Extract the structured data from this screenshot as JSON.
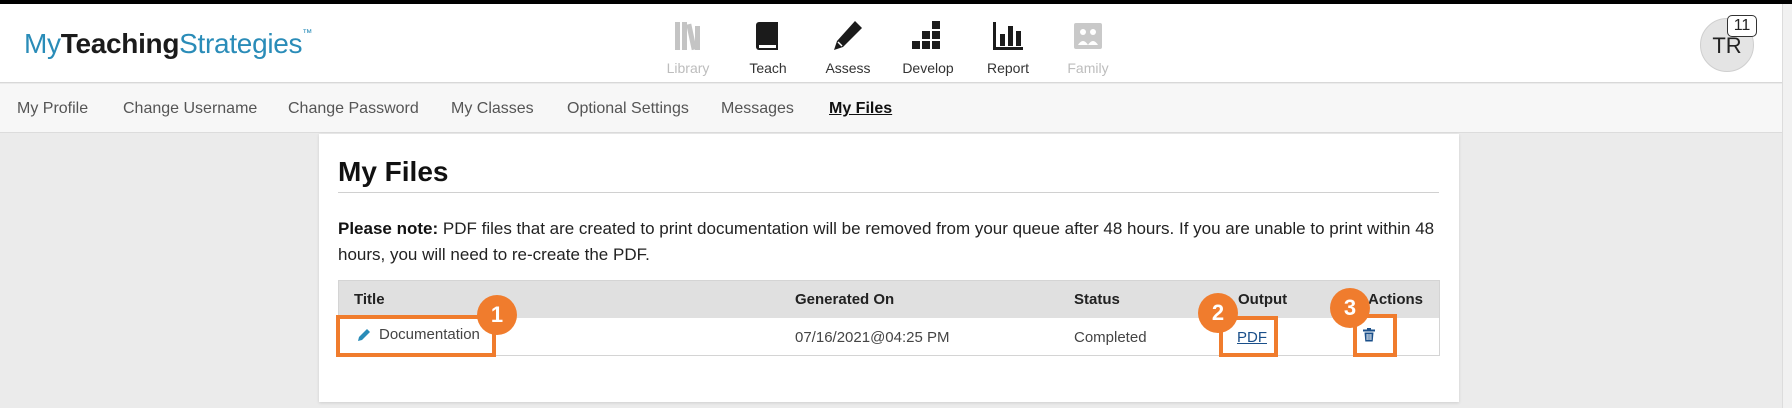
{
  "logo": {
    "part1": "My",
    "part2": "Teaching",
    "part3": "Strategies",
    "tm": "™"
  },
  "nav": [
    {
      "label": "Library",
      "icon": "library-icon",
      "disabled": true
    },
    {
      "label": "Teach",
      "icon": "book-icon",
      "disabled": false
    },
    {
      "label": "Assess",
      "icon": "pencil-icon",
      "disabled": false
    },
    {
      "label": "Develop",
      "icon": "blocks-icon",
      "disabled": false
    },
    {
      "label": "Report",
      "icon": "bar-chart-icon",
      "disabled": false
    },
    {
      "label": "Family",
      "icon": "family-photo-icon",
      "disabled": true
    }
  ],
  "user": {
    "initials": "TR",
    "notification_count": "11"
  },
  "subnav": [
    "My Profile",
    "Change Username",
    "Change Password",
    "My Classes",
    "Optional Settings",
    "Messages",
    "My Files"
  ],
  "subnav_active": "My Files",
  "page": {
    "title": "My Files",
    "note_bold": "Please note:",
    "note_text": " PDF files that are created to print documentation will be removed from your queue after 48 hours. If you are unable to print within 48 hours, you will need to re-create the PDF."
  },
  "table": {
    "headers": {
      "title": "Title",
      "generated": "Generated On",
      "status": "Status",
      "output": "Output",
      "actions": "Actions"
    },
    "rows": [
      {
        "title": "Documentation",
        "generated": "07/16/2021@04:25 PM",
        "status": "Completed",
        "output": "PDF"
      }
    ]
  },
  "annotations": [
    "1",
    "2",
    "3"
  ],
  "colors": {
    "accent": "#2a8cb8",
    "highlight": "#f07c2d",
    "link": "#1a4f8a"
  }
}
